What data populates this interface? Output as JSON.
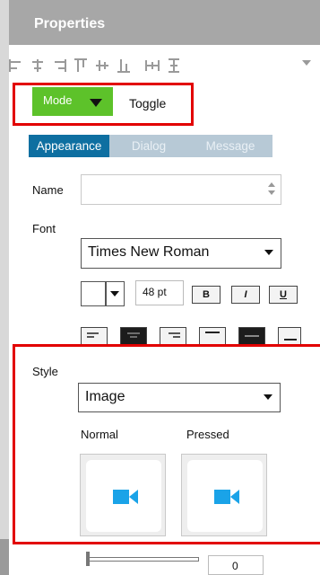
{
  "panel": {
    "title": "Properties"
  },
  "align_toolbar": {
    "icons": [
      "align-left-icon",
      "align-center-icon",
      "align-right-icon",
      "align-top-icon",
      "align-middle-icon",
      "align-bottom-icon",
      "distribute-horizontal-icon",
      "distribute-vertical-icon",
      "more-chevron-icon"
    ]
  },
  "mode": {
    "label": "Mode",
    "value": "Toggle",
    "accent": "#5dc22a"
  },
  "tabs": [
    {
      "label": "Appearance",
      "active": true
    },
    {
      "label": "Dialog",
      "active": false
    },
    {
      "label": "Message",
      "active": false
    }
  ],
  "name_field": {
    "label": "Name",
    "value": ""
  },
  "font": {
    "label": "Font",
    "family": "Times New Roman",
    "size": "48 pt",
    "bold_label": "B",
    "italic_label": "I",
    "underline_label": "U",
    "alignment_icons": [
      "text-align-left-icon",
      "text-align-center-icon",
      "text-align-right-icon",
      "valign-top-icon",
      "valign-middle-icon",
      "valign-bottom-icon"
    ]
  },
  "style": {
    "label": "Style",
    "value": "Image",
    "normal_label": "Normal",
    "pressed_label": "Pressed",
    "image_icon": "video-camera-icon",
    "image_icon_color": "#1aa3e8"
  },
  "slider": {
    "value": "0"
  },
  "highlight_color": "#e20000"
}
